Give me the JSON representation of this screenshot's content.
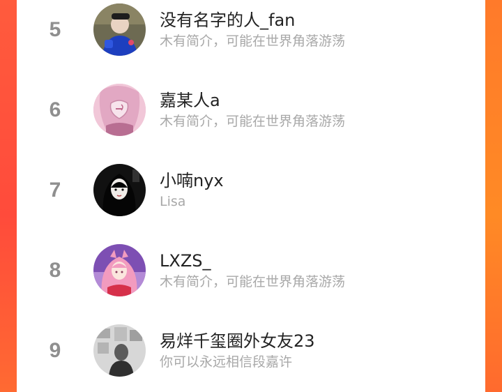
{
  "ranking": {
    "items": [
      {
        "rank": "5",
        "name": "没有名字的人_fan",
        "bio": "木有简介，可能在世界角落游荡",
        "avatar_icon": "avatar-person-blue-icon"
      },
      {
        "rank": "6",
        "name": "嘉某人a",
        "bio": "木有简介，可能在世界角落游荡",
        "avatar_icon": "avatar-pink-anime-icon"
      },
      {
        "rank": "7",
        "name": "小喃nyx",
        "bio": "Lisa",
        "avatar_icon": "avatar-dark-portrait-icon"
      },
      {
        "rank": "8",
        "name": "LXZS_",
        "bio": "木有简介，可能在世界角落游荡",
        "avatar_icon": "avatar-pink-anime-girl-icon"
      },
      {
        "rank": "9",
        "name": "易烊千玺圈外女友23",
        "bio": "你可以永远相信段嘉许",
        "avatar_icon": "avatar-gray-photo-icon"
      }
    ]
  },
  "colors": {
    "rank": "#8f8f8f",
    "name": "#222222",
    "bio": "#a8a8a8",
    "side_left": "#ff4b3b",
    "side_right": "#ff8a25"
  }
}
